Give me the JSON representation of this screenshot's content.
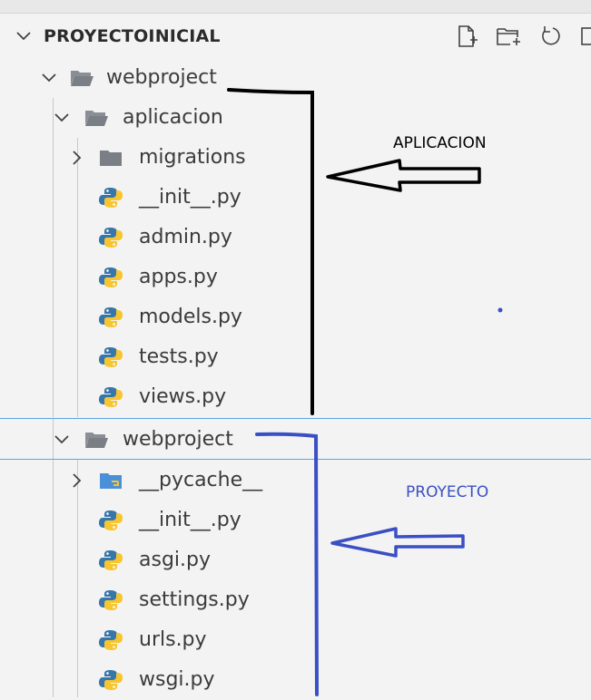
{
  "explorer": {
    "section_title": "PROYECTOINICIAL",
    "toolbar_icons": [
      "new-file-icon",
      "new-folder-icon",
      "refresh-icon"
    ]
  },
  "tree": {
    "root_folder": "webproject",
    "app_folder": "aplicacion",
    "app_items": [
      "migrations",
      "__init__.py",
      "admin.py",
      "apps.py",
      "models.py",
      "tests.py",
      "views.py"
    ],
    "project_folder": "webproject",
    "project_items": [
      "__pycache__",
      "__init__.py",
      "asgi.py",
      "settings.py",
      "urls.py",
      "wsgi.py"
    ]
  },
  "annotations": {
    "app_label": "APLICACION",
    "project_label": "PROYECTO",
    "app_color": "#000000",
    "project_color": "#3b4fc4"
  },
  "colors": {
    "background": "#f3f3f3",
    "focus_line": "#5aa4e0",
    "folder": "#7a7f86",
    "python_blue": "#3776ab",
    "python_yellow": "#f7c530",
    "pycache_folder": "#4a90d9"
  }
}
